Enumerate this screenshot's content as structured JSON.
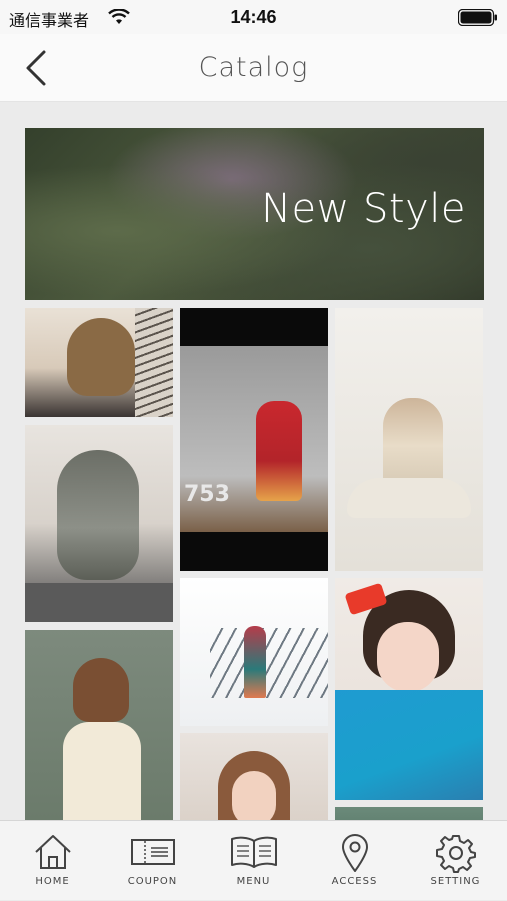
{
  "status_bar": {
    "carrier": "通信事業者",
    "time": "14:46"
  },
  "nav": {
    "title": "Catalog"
  },
  "banner": {
    "text": "New Style"
  },
  "photos": {
    "p3_number": "753"
  },
  "tabs": [
    {
      "label": "HOME",
      "icon": "home-icon"
    },
    {
      "label": "COUPON",
      "icon": "coupon-icon"
    },
    {
      "label": "MENU",
      "icon": "book-icon"
    },
    {
      "label": "ACCESS",
      "icon": "location-pin-icon"
    },
    {
      "label": "SETTING",
      "icon": "gear-icon"
    }
  ]
}
